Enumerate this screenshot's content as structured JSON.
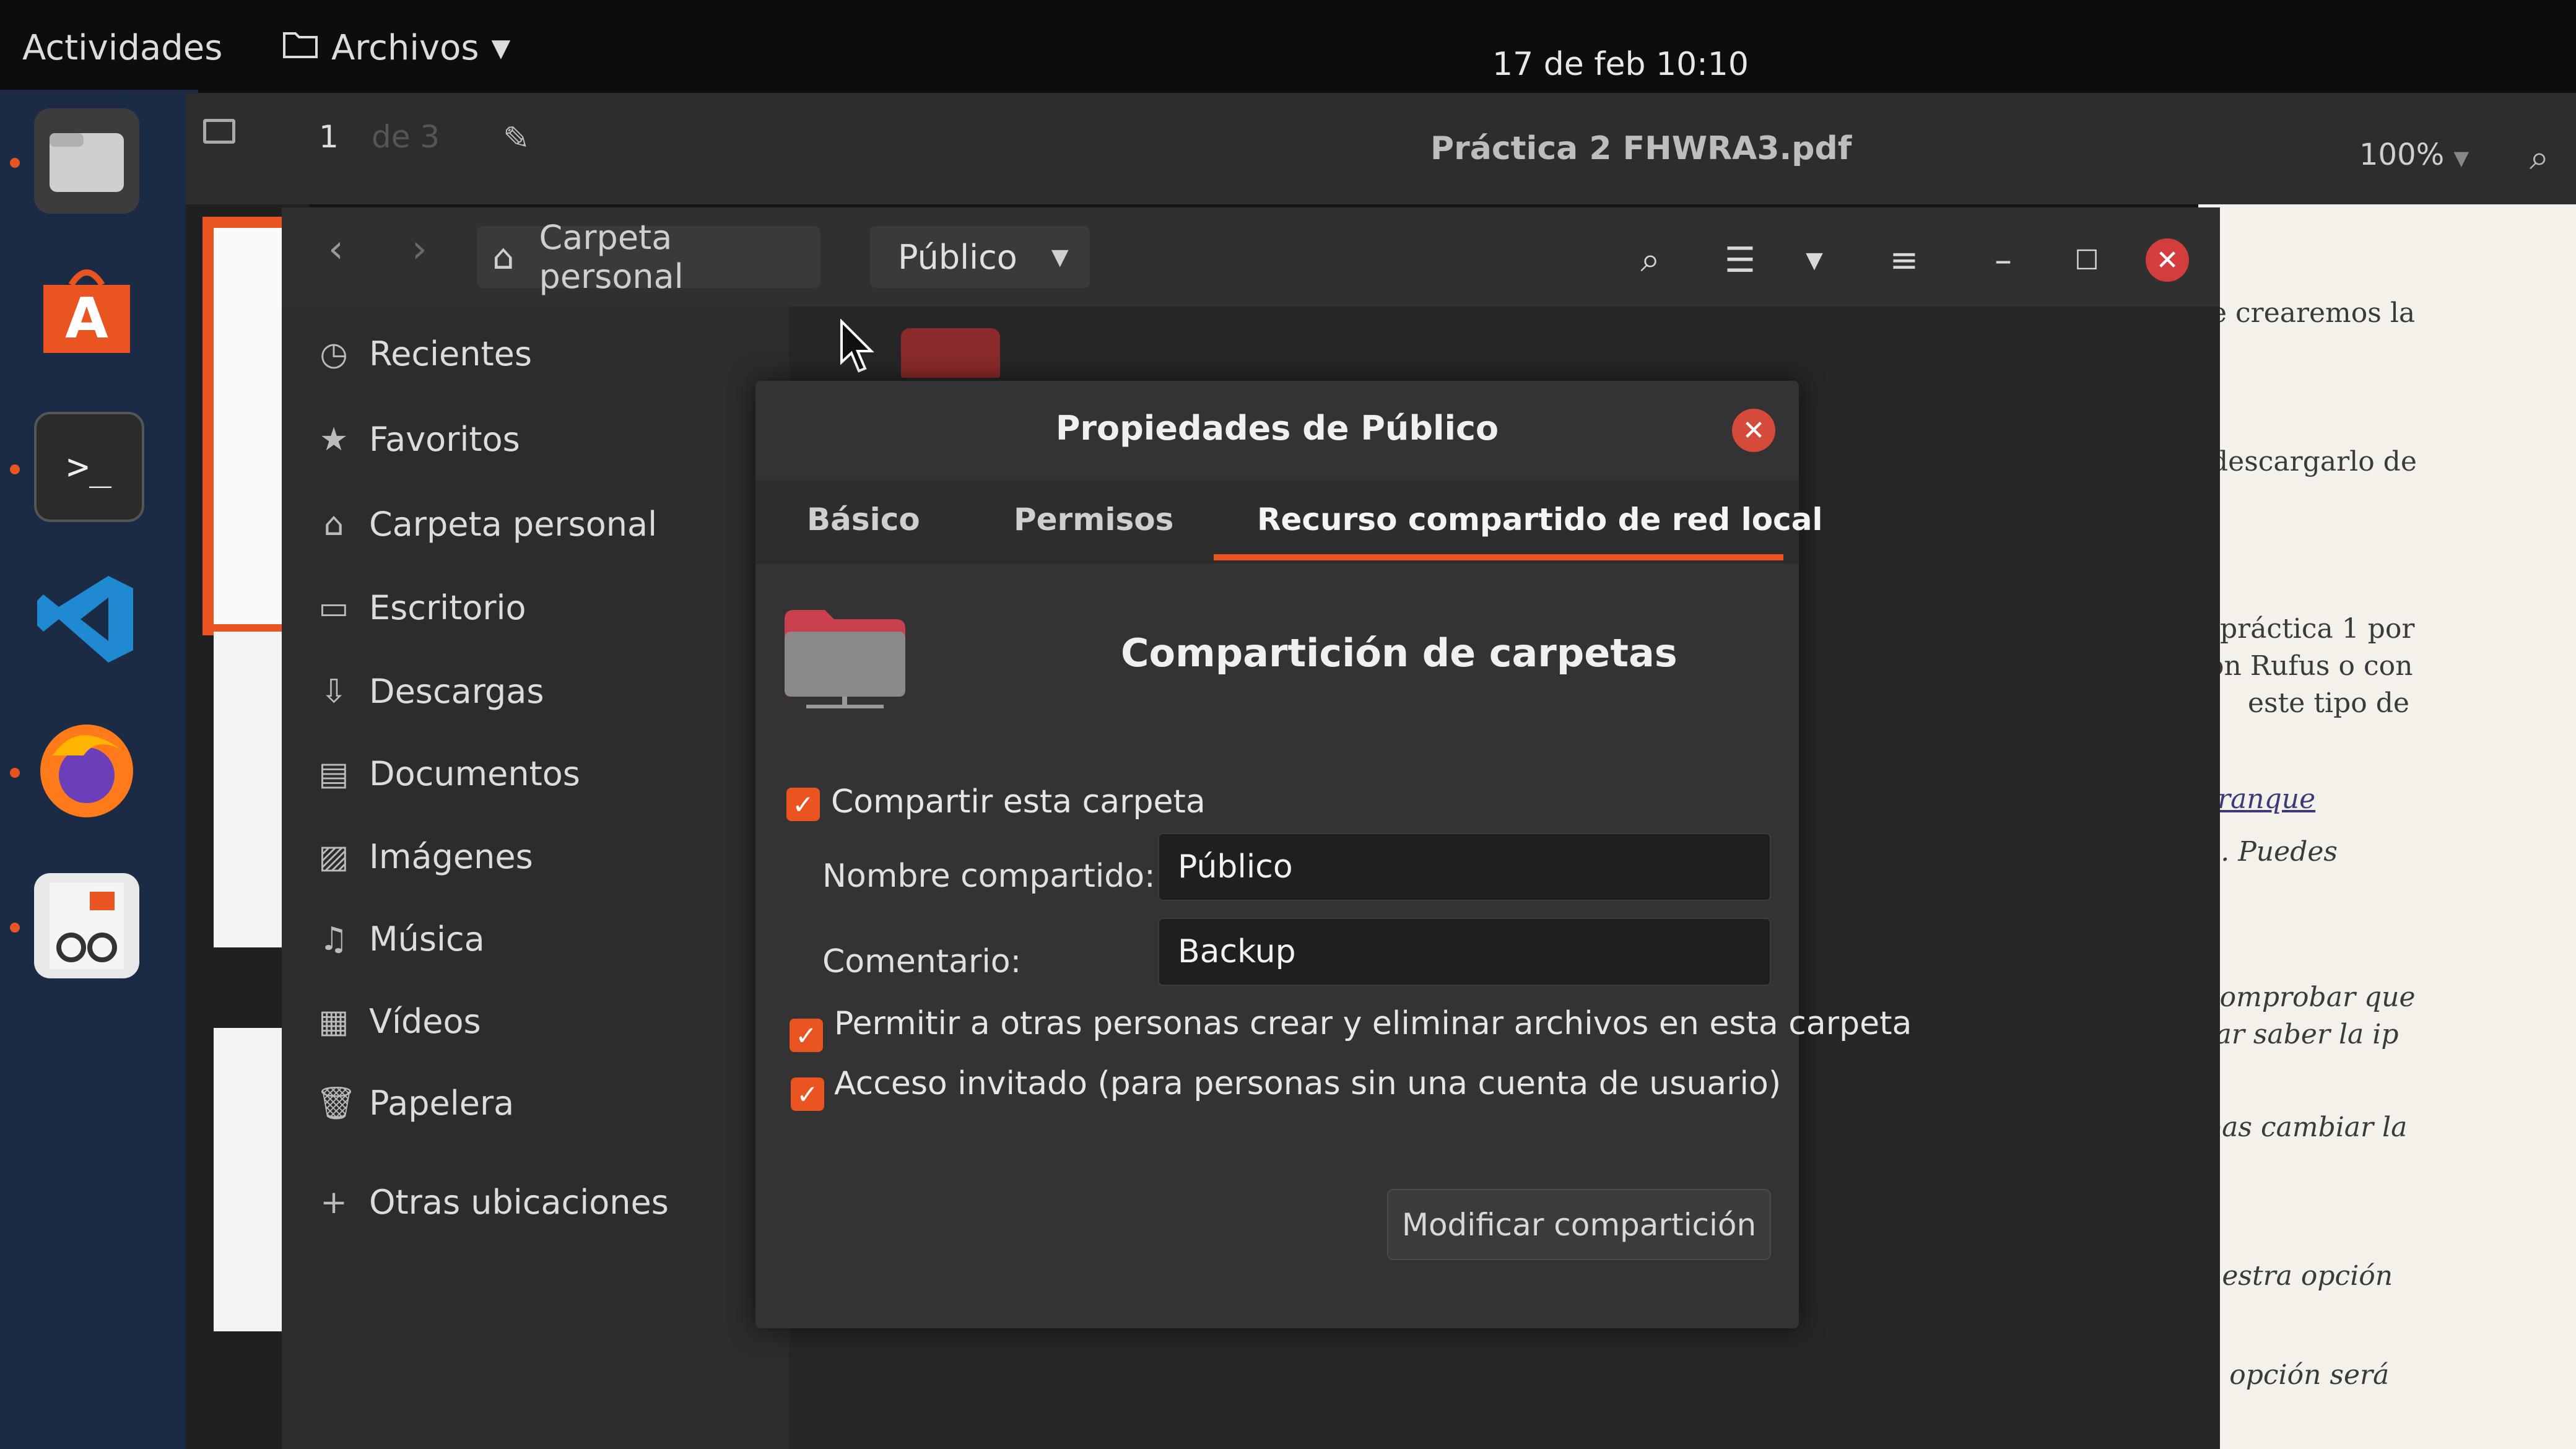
{
  "topbar": {
    "activities": "Actividades",
    "app_menu": "Archivos",
    "clock": "17 de feb  10:10"
  },
  "pdf_viewer": {
    "page_number": "1",
    "page_of": "de 3",
    "title": "Práctica 2 FHWRA3.pdf",
    "zoom": "100%",
    "page_text": [
      "e crearemos la",
      "descargarlo de",
      "práctica 1 por",
      "on Rufus o con",
      "este  tipo  de",
      "rranque",
      "a. Puedes",
      "comprobar que",
      "tar saber la ip",
      "bas cambiar la",
      "uestra opción",
      "a opción será"
    ]
  },
  "files": {
    "breadcrumb_home": "Carpeta personal",
    "breadcrumb_current": "Público",
    "sidebar": [
      {
        "label": "Recientes",
        "icon": "clock-icon"
      },
      {
        "label": "Favoritos",
        "icon": "star-icon"
      },
      {
        "label": "Carpeta personal",
        "icon": "home-icon"
      },
      {
        "label": "Escritorio",
        "icon": "desktop-icon"
      },
      {
        "label": "Descargas",
        "icon": "download-icon"
      },
      {
        "label": "Documentos",
        "icon": "document-icon"
      },
      {
        "label": "Imágenes",
        "icon": "image-icon"
      },
      {
        "label": "Música",
        "icon": "music-icon"
      },
      {
        "label": "Vídeos",
        "icon": "video-icon"
      },
      {
        "label": "Papelera",
        "icon": "trash-icon"
      },
      {
        "label": "Otras ubicaciones",
        "icon": "plus-icon"
      }
    ]
  },
  "dialog": {
    "title": "Propiedades de Público",
    "tabs": [
      "Básico",
      "Permisos",
      "Recurso compartido de red local"
    ],
    "active_tab": 2,
    "heading": "Compartición de carpetas",
    "share_checkbox": {
      "label": "Compartir esta carpeta",
      "checked": true
    },
    "share_name_label": "Nombre compartido:",
    "share_name_value": "Público",
    "comment_label": "Comentario:",
    "comment_value": "Backup",
    "allow_checkbox": {
      "label": "Permitir a otras personas crear y eliminar archivos en esta carpeta",
      "checked": true
    },
    "guest_checkbox": {
      "label": "Acceso invitado (para personas sin una cuenta de usuario)",
      "checked": true
    },
    "modify_button": "Modificar compartición"
  },
  "colors": {
    "accent": "#e95420",
    "close": "#d64a3b",
    "dock": "#1b2a45"
  }
}
